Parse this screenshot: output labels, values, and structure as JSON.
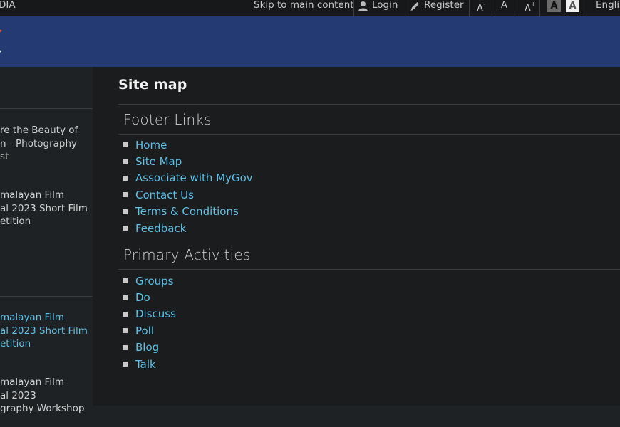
{
  "topbar": {
    "brand": "DIA",
    "skip_link": "Skip to main content",
    "login": "Login",
    "register": "Register",
    "font_decrease": "A",
    "font_decrease_sup": "-",
    "font_normal": "A",
    "font_increase": "A",
    "font_increase_sup": "+",
    "contrast_dark": "A",
    "contrast_light": "A",
    "language": "Englis"
  },
  "sidebar": {
    "items": [
      {
        "text": "re the Beauty of\nn - Photography\nst"
      },
      {
        "text": "malayan Film\nal 2023 Short Film\netition"
      },
      {
        "text": "malayan Film\nal 2023 Short Film\netition"
      },
      {
        "text": "malayan Film\nal 2023\ngraphy Workshop"
      }
    ]
  },
  "main": {
    "page_title": "Site map",
    "sections": [
      {
        "title": "Footer Links",
        "links": [
          "Home",
          "Site Map",
          "Associate with MyGov",
          "Contact Us",
          "Terms & Conditions",
          "Feedback"
        ]
      },
      {
        "title": "Primary Activities",
        "links": [
          "Groups",
          "Do",
          "Discuss",
          "Poll",
          "Blog",
          "Talk"
        ]
      }
    ]
  },
  "colors": {
    "banner": "#233a72",
    "link": "#5fc0e8",
    "background": "#1a1c1e"
  }
}
